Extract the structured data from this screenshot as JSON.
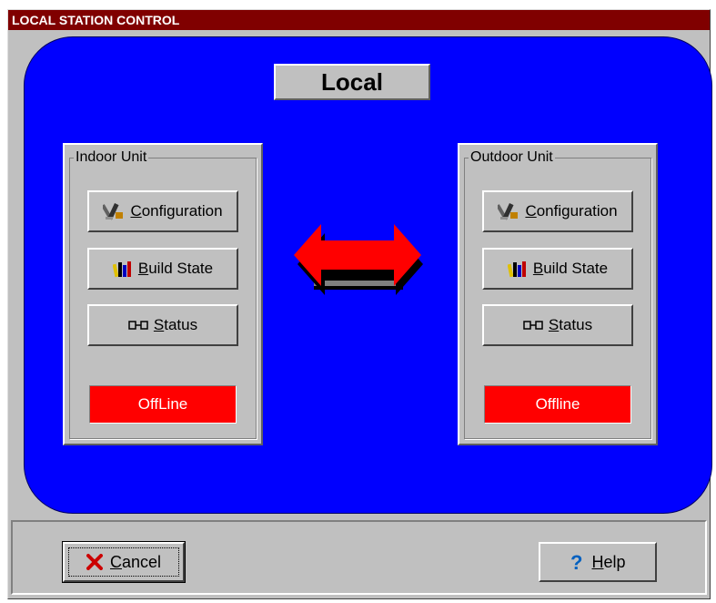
{
  "window": {
    "title": "LOCAL STATION CONTROL"
  },
  "mode_label": "Local",
  "indoor": {
    "group_label": "Indoor Unit",
    "configuration": {
      "accel": "C",
      "rest": "onfiguration"
    },
    "build_state": {
      "accel": "B",
      "rest": "uild State"
    },
    "status": {
      "accel": "S",
      "rest": "tatus"
    },
    "connection_state": "OffLine"
  },
  "outdoor": {
    "group_label": "Outdoor Unit",
    "configuration": {
      "accel": "C",
      "rest": "onfiguration"
    },
    "build_state": {
      "accel": "B",
      "rest": "uild State"
    },
    "status": {
      "accel": "S",
      "rest": "tatus"
    },
    "connection_state": "Offline"
  },
  "cancel": {
    "accel": "C",
    "rest": "ancel"
  },
  "help": {
    "accel": "H",
    "rest": "elp"
  },
  "colors": {
    "titlebar": "#800000",
    "panel": "#0000ff",
    "offline": "#ff0000",
    "arrow": "#ff0000",
    "face": "#c0c0c0"
  },
  "icons": {
    "configuration": "wrench-hammer-icon",
    "build_state": "books-icon",
    "status": "connector-icon",
    "cancel": "red-x-icon",
    "help": "question-mark-icon",
    "link": "double-arrow-icon"
  }
}
